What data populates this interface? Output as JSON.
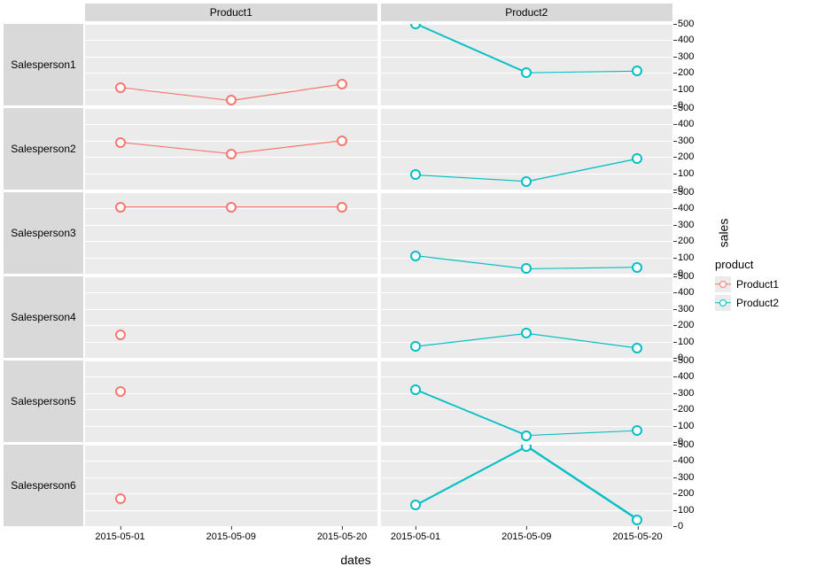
{
  "chart_data": {
    "type": "line",
    "xlabel": "dates",
    "ylabel": "sales",
    "ylim": [
      0,
      500
    ],
    "yticks": [
      0,
      100,
      200,
      300,
      400,
      500
    ],
    "x": [
      "2015-05-01",
      "2015-05-09",
      "2015-05-20"
    ],
    "legend_title": "product",
    "legend": [
      "Product1",
      "Product2"
    ],
    "colors": {
      "Product1": "#F8766D",
      "Product2": "#00BFC4"
    },
    "col_facets": [
      "Product1",
      "Product2"
    ],
    "row_facets": [
      "Salesperson1",
      "Salesperson2",
      "Salesperson3",
      "Salesperson4",
      "Salesperson5",
      "Salesperson6"
    ],
    "panels": {
      "Salesperson1": {
        "Product1": [
          110,
          30,
          130
        ],
        "Product2": [
          500,
          200,
          210
        ]
      },
      "Salesperson2": {
        "Product1": [
          290,
          220,
          300
        ],
        "Product2": [
          90,
          50,
          190
        ]
      },
      "Salesperson3": {
        "Product1": [
          410,
          410,
          410
        ],
        "Product2": [
          110,
          30,
          40
        ]
      },
      "Salesperson4": {
        "Product1": [
          140,
          null,
          null
        ],
        "Product2": [
          70,
          150,
          60
        ]
      },
      "Salesperson5": {
        "Product1": [
          310,
          null,
          null
        ],
        "Product2": [
          320,
          40,
          70
        ]
      },
      "Salesperson6": {
        "Product1": [
          170,
          null,
          null
        ],
        "Product2": [
          130,
          490,
          40
        ]
      }
    }
  }
}
